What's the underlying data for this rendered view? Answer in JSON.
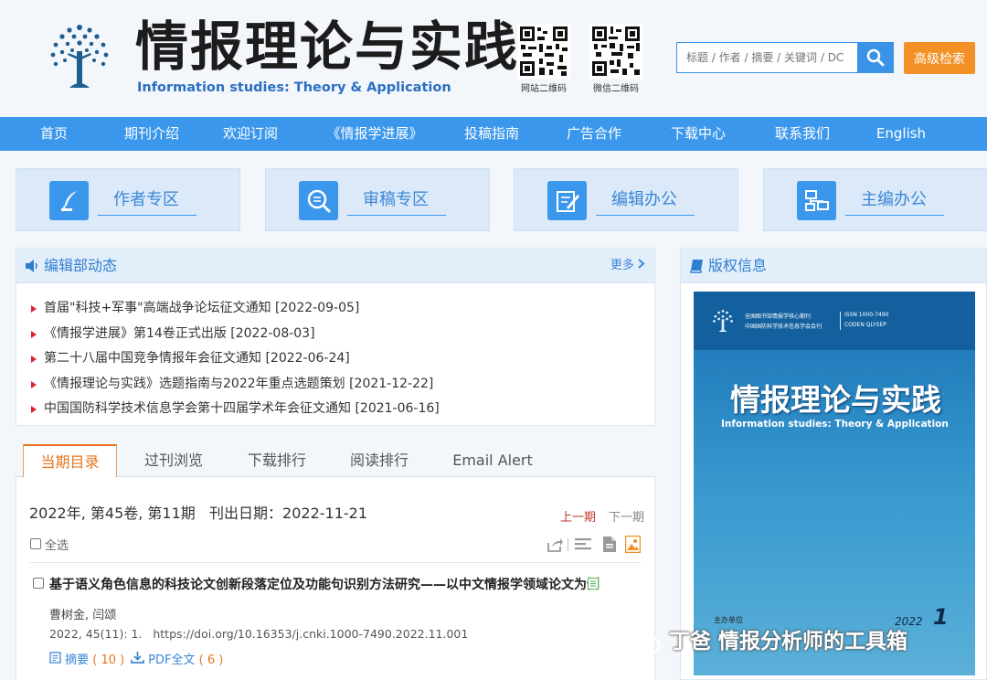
{
  "header": {
    "title": "情报理论与实践",
    "subtitle": "Information studies: Theory & Application",
    "qr_site_caption": "网站二维码",
    "qr_wechat_caption": "微信二维码",
    "search_placeholder": "标题 / 作者 / 摘要 / 关键词 / DC",
    "advanced_search_label": "高级检索"
  },
  "nav": {
    "items": [
      "首页",
      "期刊介绍",
      "欢迎订阅",
      "《情报学进展》",
      "投稿指南",
      "广告合作",
      "下载中心",
      "联系我们",
      "English"
    ]
  },
  "zones": [
    "作者专区",
    "审稿专区",
    "编辑办公",
    "主编办公"
  ],
  "news": {
    "title": "编辑部动态",
    "more_label": "更多",
    "items": [
      "首届\"科技+军事\"高端战争论坛征文通知 [2022-09-05]",
      "《情报学进展》第14卷正式出版 [2022-08-03]",
      "第二十八届中国竞争情报年会征文通知 [2022-06-24]",
      "《情报理论与实践》选题指南与2022年重点选题策划 [2021-12-22]",
      "中国国防科学技术信息学会第十四届学术年会征文通知 [2021-06-16]"
    ]
  },
  "tabs": [
    "当期目录",
    "过刊浏览",
    "下载排行",
    "阅读排行",
    "Email Alert"
  ],
  "issue": {
    "info": "2022年, 第45卷, 第11期   刊出日期：2022-11-21",
    "prev_label": "上一期",
    "next_label": "下一期",
    "select_all_label": "全选",
    "article": {
      "title": "基于语义角色信息的科技论文创新段落定位及功能句识别方法研究——以中文情报学领域论文为例",
      "authors": "曹树金, 闫颂",
      "citation": "2022, 45(11): 1.   https://doi.org/10.16353/j.cnki.1000-7490.2022.11.001",
      "abstract_label": "摘要",
      "abstract_count": "( 10 )",
      "pdf_label": "PDF全文",
      "pdf_count": "( 6 )"
    }
  },
  "copyright": {
    "title": "版权信息",
    "cover": {
      "header_line1": "全国图书馆情报学核心期刊",
      "header_line2": "中国国防科学技术信息学会会刊",
      "issn": "ISSN 1000-7490",
      "coden": "CODEN QLYSEP",
      "title": "情报理论与实践",
      "subtitle": "Information studies: Theory & Application",
      "host_label": "主办单位",
      "year": "2022",
      "issue_no": "1"
    }
  },
  "watermark": "丁爸 情报分析师的工具箱",
  "colors": {
    "nav_blue": "#3b97ec",
    "accent_orange": "#f29126",
    "tab_orange": "#e8761e"
  }
}
